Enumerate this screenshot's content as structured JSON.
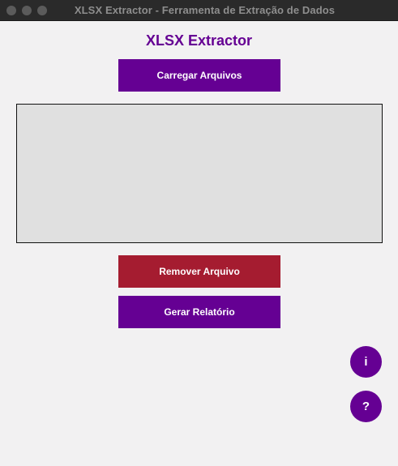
{
  "window": {
    "title": "XLSX Extractor - Ferramenta de Extração de Dados"
  },
  "app": {
    "title": "XLSX Extractor"
  },
  "buttons": {
    "load_files": "Carregar Arquivos",
    "remove_file": "Remover Arquivo",
    "generate_report": "Gerar Relatório"
  },
  "file_list": {
    "items": []
  },
  "floating": {
    "info_label": "i",
    "help_label": "?"
  },
  "colors": {
    "primary": "#650093",
    "danger": "#a51c30",
    "list_bg": "#e0e0e0",
    "background": "#f2f1f2"
  }
}
